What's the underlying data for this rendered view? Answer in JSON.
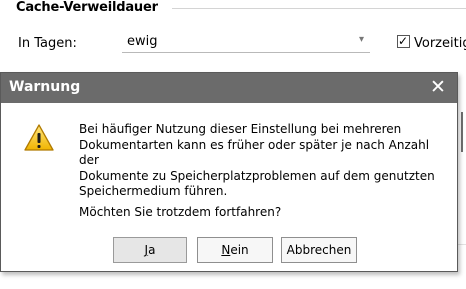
{
  "settings": {
    "group_title": "Cache-Verweildauer",
    "days_label": "In Tagen:",
    "days_value": "ewig",
    "preload_label": "Vorzeitig",
    "preload_checked": true
  },
  "dialog": {
    "title": "Warnung",
    "close_glyph": "✕",
    "message_lines": [
      "Bei häufiger Nutzung dieser Einstellung bei mehreren",
      "Dokumentarten kann es früher oder später je nach Anzahl der",
      "Dokumente zu Speicherplatzproblemen auf dem genutzten",
      "Speichermedium führen."
    ],
    "question": "Möchten Sie trotzdem fortfahren?",
    "buttons": {
      "yes_mnemonic": "J",
      "yes_rest": "a",
      "no_mnemonic": "N",
      "no_rest": "ein",
      "cancel": "Abbrechen"
    },
    "icon": "warning-icon"
  },
  "colors": {
    "titlebar": "#6b6b6b",
    "warning_yellow": "#f2c200"
  }
}
